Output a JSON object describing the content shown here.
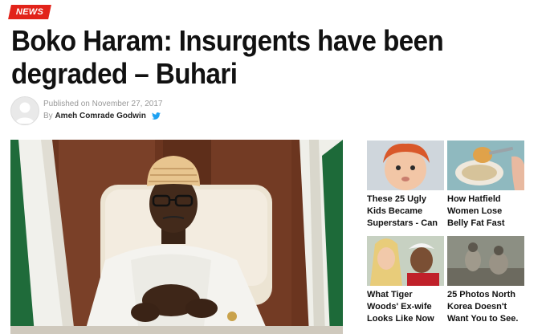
{
  "badge": {
    "label": "NEWS"
  },
  "article": {
    "title": "Boko Haram: Insurgents have been degraded – Buhari",
    "published_prefix": "Published on",
    "published_date": "November 27, 2017",
    "by_prefix": "By",
    "author": "Ameh Comrade Godwin"
  },
  "hero_image": {
    "alt": "President seated at a desk with flags behind"
  },
  "ads": [
    {
      "line1": "These 25 Ugly",
      "line2": "Kids Became",
      "line3": "Superstars - Can"
    },
    {
      "line1": "How Hatfield",
      "line2": "Women Lose",
      "line3": "Belly Fat Fast"
    },
    {
      "line1": "What Tiger",
      "line2": "Woods' Ex-wife",
      "line3": "Looks Like Now"
    },
    {
      "line1": "25 Photos North",
      "line2": "Korea Doesn't",
      "line3": "Want You to See."
    }
  ],
  "colors": {
    "accent": "#e2231a",
    "twitter": "#1da1f2",
    "meta_gray": "#999999"
  }
}
